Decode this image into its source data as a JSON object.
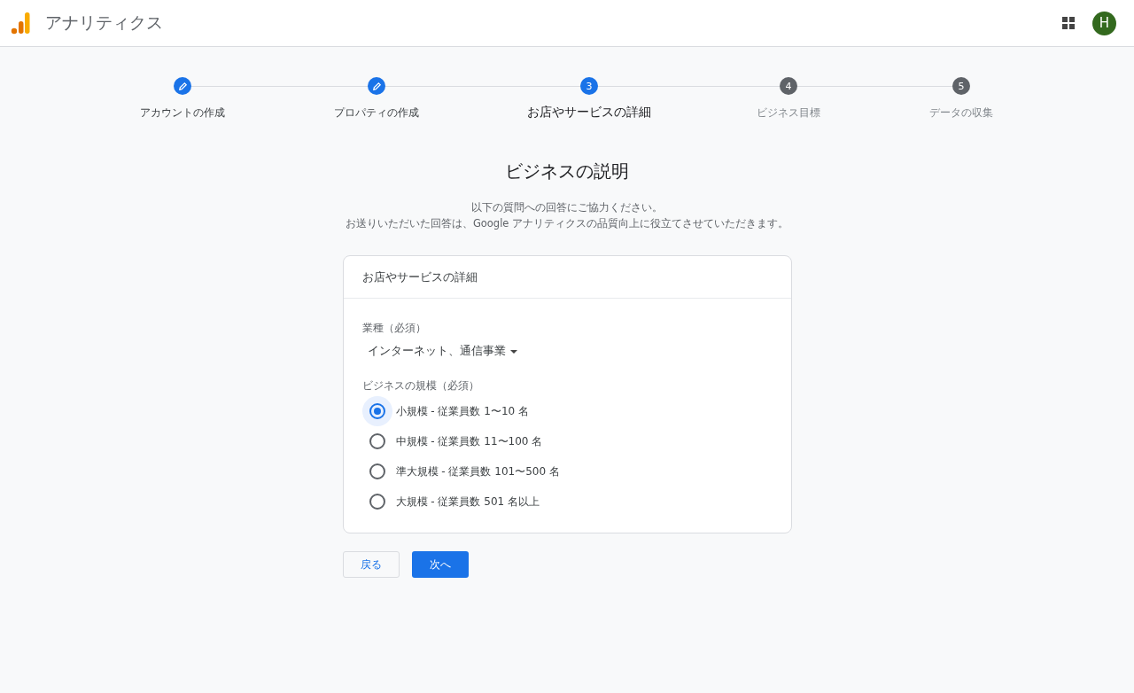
{
  "header": {
    "title": "アナリティクス",
    "avatar": "H"
  },
  "steps": [
    {
      "kind": "done",
      "label": "アカウントの作成"
    },
    {
      "kind": "done",
      "label": "プロパティの作成"
    },
    {
      "kind": "current",
      "number": "3",
      "label": "お店やサービスの詳細"
    },
    {
      "kind": "pending",
      "number": "4",
      "label": "ビジネス目標"
    },
    {
      "kind": "pending",
      "number": "5",
      "label": "データの収集"
    }
  ],
  "heading": "ビジネスの説明",
  "intro": [
    "以下の質問への回答にご協力ください。",
    "お送りいただいた回答は、Google アナリティクスの品質向上に役立てさせていただきます。"
  ],
  "card": {
    "title": "お店やサービスの詳細",
    "industry": {
      "label": "業種（必須）",
      "value": "インターネット、通信事業"
    },
    "size": {
      "label": "ビジネスの規模（必須）",
      "options": [
        {
          "label": "小規模 - 従業員数 1〜10 名",
          "selected": true
        },
        {
          "label": "中規模 - 従業員数 11〜100 名",
          "selected": false
        },
        {
          "label": "準大規模 - 従業員数 101〜500 名",
          "selected": false
        },
        {
          "label": "大規模 - 従業員数 501 名以上",
          "selected": false
        }
      ]
    }
  },
  "buttons": {
    "back": "戻る",
    "next": "次へ"
  }
}
